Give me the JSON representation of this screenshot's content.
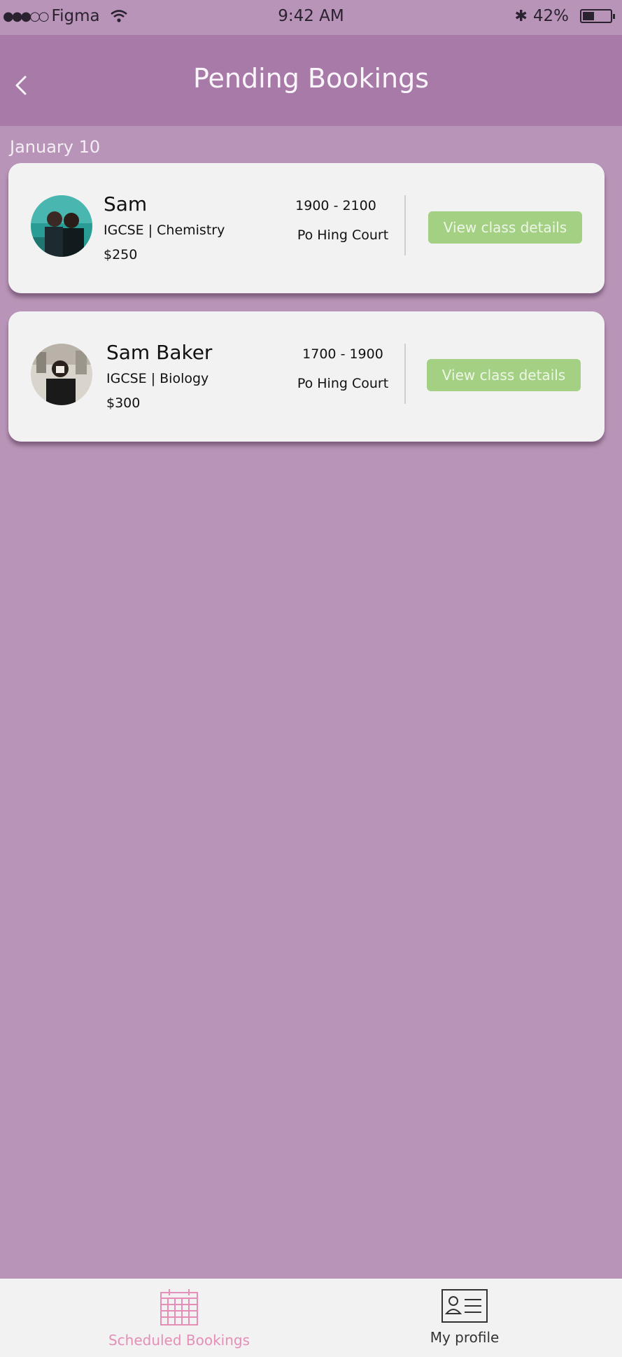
{
  "status_bar": {
    "signal": "●●●○○",
    "carrier": "Figma",
    "time": "9:42 AM",
    "bluetooth": "✱",
    "battery_text": "42%",
    "battery_level": 0.42,
    "icons": [
      "wifi-icon",
      "bluetooth-icon",
      "battery-icon"
    ]
  },
  "header": {
    "title": "Pending Bookings",
    "back_icon": "chevron-left-icon"
  },
  "date_group": "January 10",
  "bookings": [
    {
      "name": "Sam",
      "subject": "IGCSE | Chemistry",
      "price": "$250",
      "time": "1900 - 2100",
      "location": "Po Hing Court",
      "button": "View class details"
    },
    {
      "name": "Sam Baker",
      "subject": "IGCSE | Biology",
      "price": "$300",
      "time": "1700 - 1900",
      "location": "Po Hing Court",
      "button": "View class details"
    }
  ],
  "tabs": [
    {
      "label": "Scheduled Bookings",
      "icon": "calendar-icon",
      "active": true
    },
    {
      "label": "My profile",
      "icon": "profile-card-icon",
      "active": false
    }
  ],
  "colors": {
    "background": "#b895b8",
    "header": "#a77aa7",
    "button": "#a3d083",
    "active_tab": "#e58fb8",
    "card": "#f2f2f2"
  }
}
